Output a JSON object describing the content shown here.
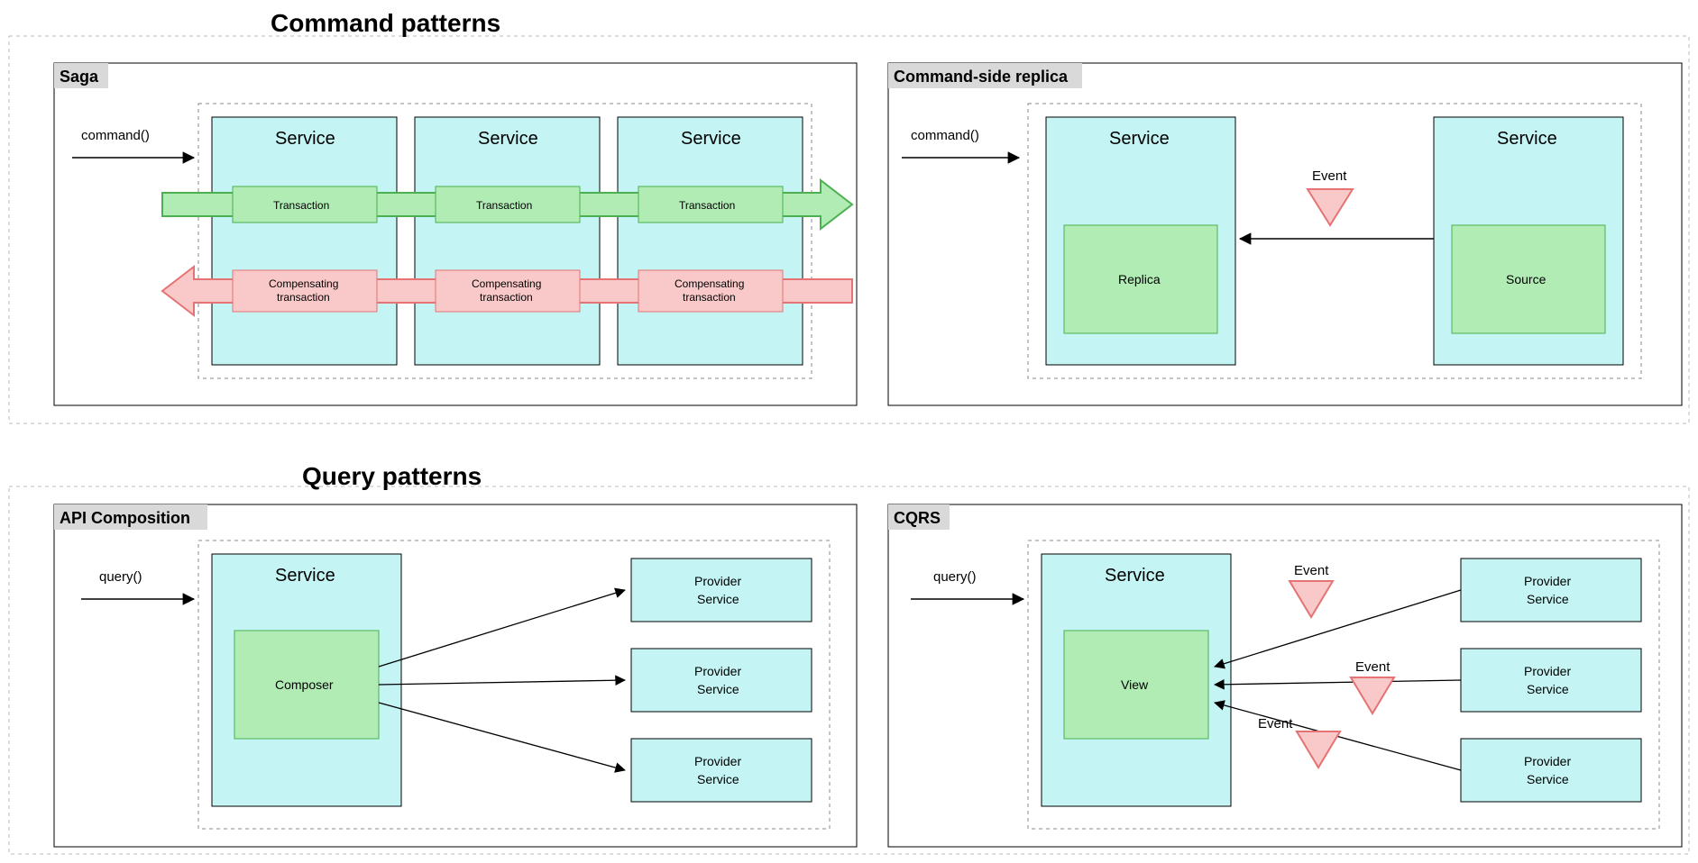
{
  "regions": {
    "command": {
      "title": "Command patterns"
    },
    "query": {
      "title": "Query patterns"
    }
  },
  "panels": {
    "saga": {
      "label": "Saga",
      "msg": "command()"
    },
    "csr": {
      "label": "Command-side replica",
      "msg": "command()"
    },
    "apicomp": {
      "label": "API Composition",
      "msg": "query()"
    },
    "cqrs": {
      "label": "CQRS",
      "msg": "query()"
    }
  },
  "saga": {
    "service_label": "Service",
    "transaction_label": "Transaction",
    "compensating_line1": "Compensating",
    "compensating_line2": "transaction"
  },
  "csr": {
    "service_label": "Service",
    "replica_label": "Replica",
    "source_label": "Source",
    "event_label": "Event"
  },
  "apicomp": {
    "service_label": "Service",
    "composer_label": "Composer",
    "provider_line1": "Provider",
    "provider_line2": "Service"
  },
  "cqrs": {
    "service_label": "Service",
    "view_label": "View",
    "event_label": "Event",
    "provider_line1": "Provider",
    "provider_line2": "Service"
  },
  "colors": {
    "service_fill": "#c4f4f4",
    "green_fill": "#b1ecb5",
    "green_stroke": "#4caf50",
    "pink_fill": "#f9c9c9",
    "pink_stroke": "#e57373",
    "gray_label": "#d9d9d9"
  }
}
